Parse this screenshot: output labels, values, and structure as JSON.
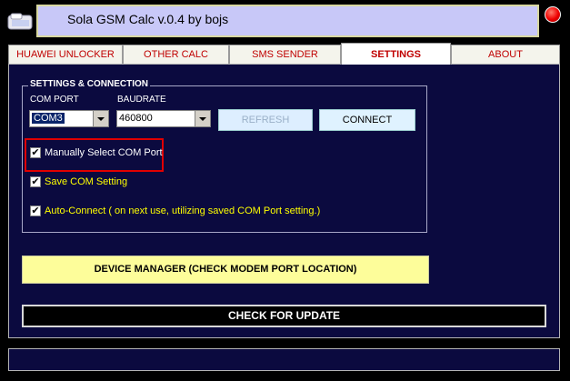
{
  "window": {
    "title": "Sola GSM Calc  v.0.4  by bojs"
  },
  "tabs": [
    {
      "label": "HUAWEI UNLOCKER",
      "active": false
    },
    {
      "label": "OTHER CALC",
      "active": false
    },
    {
      "label": "SMS SENDER",
      "active": false
    },
    {
      "label": "SETTINGS",
      "active": true
    },
    {
      "label": "ABOUT",
      "active": false
    }
  ],
  "settings": {
    "group_title": "SETTINGS & CONNECTION",
    "com_port_label": "COM PORT",
    "com_port_value": "COM3",
    "baudrate_label": "BAUDRATE",
    "baudrate_value": "460800",
    "refresh_label": "REFRESH",
    "connect_label": "CONNECT",
    "manual_select_label": "Manually Select COM Port",
    "manual_select_checked": true,
    "save_com_label": "Save COM Setting",
    "save_com_checked": true,
    "auto_connect_label": "Auto-Connect ( on next use, utilizing saved COM Port setting.)",
    "auto_connect_checked": true
  },
  "actions": {
    "device_manager_label": "DEVICE MANAGER (CHECK MODEM PORT LOCATION)",
    "check_update_label": "CHECK FOR UPDATE"
  },
  "colors": {
    "panel_bg": "#0b0a3f",
    "tab_text": "#c00000",
    "checkbox_label_yellow": "#ffff00",
    "highlight_border": "#e00000",
    "device_manager_bg": "#fdfd9a"
  },
  "icons": {
    "app": "app-window-icon",
    "close": "close-icon",
    "checkmark": "✔"
  }
}
